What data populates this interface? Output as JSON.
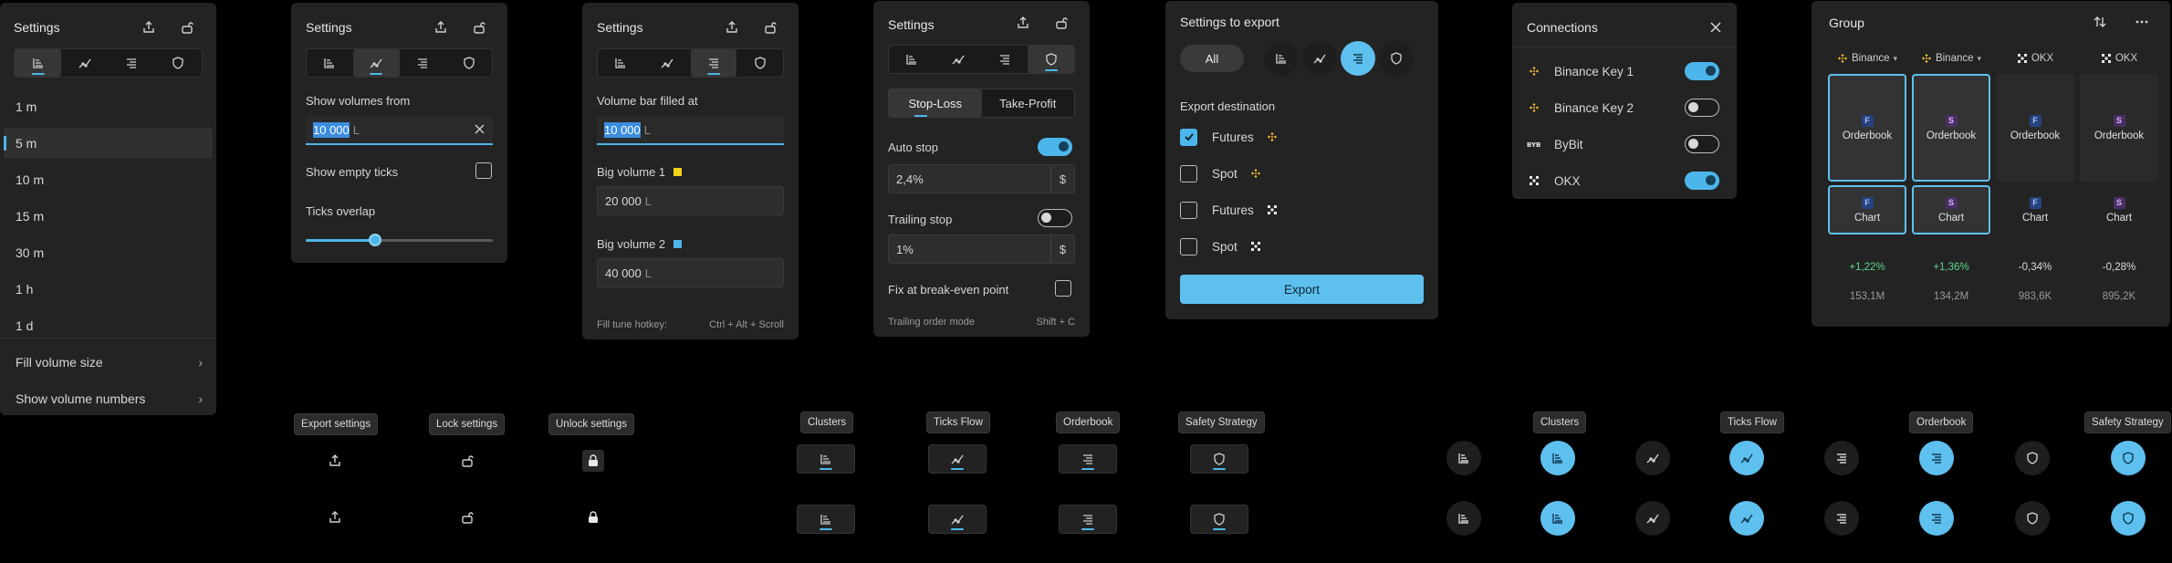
{
  "p1": {
    "title": "Settings",
    "timeframes": [
      "1 m",
      "5 m",
      "10 m",
      "15 m",
      "30 m",
      "1 h",
      "1 d"
    ],
    "selected": "5 m",
    "menu": [
      "Fill volume size",
      "Show volume numbers"
    ]
  },
  "p2": {
    "title": "Settings",
    "show_volumes_label": "Show volumes from",
    "show_volumes_value": "10 000",
    "unit": "L",
    "show_empty_label": "Show empty ticks",
    "overlap_label": "Ticks overlap",
    "overlap_value": 0.36
  },
  "p3": {
    "title": "Settings",
    "volume_bar_label": "Volume bar filled at",
    "volume_bar_value": "10 000",
    "unit": "L",
    "big1_label": "Big volume 1",
    "big1_value": "20 000",
    "big1_color": "#f3d21b",
    "big2_label": "Big volume 2",
    "big2_value": "40 000",
    "big2_color": "#4cb6ea",
    "hotkey_label": "Fill tune hotkey:",
    "hotkey_value": "Ctrl + Alt + Scroll"
  },
  "p4": {
    "title": "Settings",
    "seg_stop": "Stop-Loss",
    "seg_take": "Take-Profit",
    "auto_stop_label": "Auto stop",
    "auto_stop_value": "2,4%",
    "currency": "$",
    "trailing_label": "Trailing stop",
    "trailing_value": "1%",
    "fix_label": "Fix at break-even point",
    "trailing_mode_label": "Trailing order mode",
    "trailing_mode_key": "Shift + C"
  },
  "p5": {
    "title": "Settings to export",
    "all_label": "All",
    "dest_label": "Export destination",
    "items": [
      {
        "label": "Futures",
        "exchange": "binance",
        "checked": true
      },
      {
        "label": "Spot",
        "exchange": "binance",
        "checked": false
      },
      {
        "label": "Futures",
        "exchange": "okx",
        "checked": false
      },
      {
        "label": "Spot",
        "exchange": "okx",
        "checked": false
      }
    ],
    "export_button": "Export"
  },
  "p6": {
    "title": "Connections",
    "items": [
      {
        "label": "Binance Key 1",
        "exchange": "binance",
        "on": true
      },
      {
        "label": "Binance Key 2",
        "exchange": "binance",
        "on": false
      },
      {
        "label": "ByBit",
        "exchange": "bybit",
        "on": false
      },
      {
        "label": "OKX",
        "exchange": "okx",
        "on": true
      }
    ]
  },
  "p7": {
    "title": "Group",
    "columns": [
      {
        "exchange": "Binance",
        "type": "F",
        "change": "+1,22%",
        "volume": "153,1M",
        "active": true
      },
      {
        "exchange": "Binance",
        "type": "S",
        "change": "+1,36%",
        "volume": "134,2M",
        "active": true
      },
      {
        "exchange": "OKX",
        "type": "F",
        "change": "-0,34%",
        "volume": "983,6K",
        "active": false
      },
      {
        "exchange": "OKX",
        "type": "S",
        "change": "-0,28%",
        "volume": "895,2K",
        "active": false
      }
    ],
    "orderbook_label": "Orderbook",
    "chart_label": "Chart"
  },
  "tips": {
    "export": "Export settings",
    "lock": "Lock settings",
    "unlock": "Unlock settings",
    "clusters": "Clusters",
    "ticks_flow": "Ticks Flow",
    "orderbook": "Orderbook",
    "safety": "Safety Strategy"
  },
  "colors": {
    "accent": "#4cb6ea",
    "panel": "#232323",
    "positive": "#5dd68a",
    "binance": "#f3ba2f"
  }
}
